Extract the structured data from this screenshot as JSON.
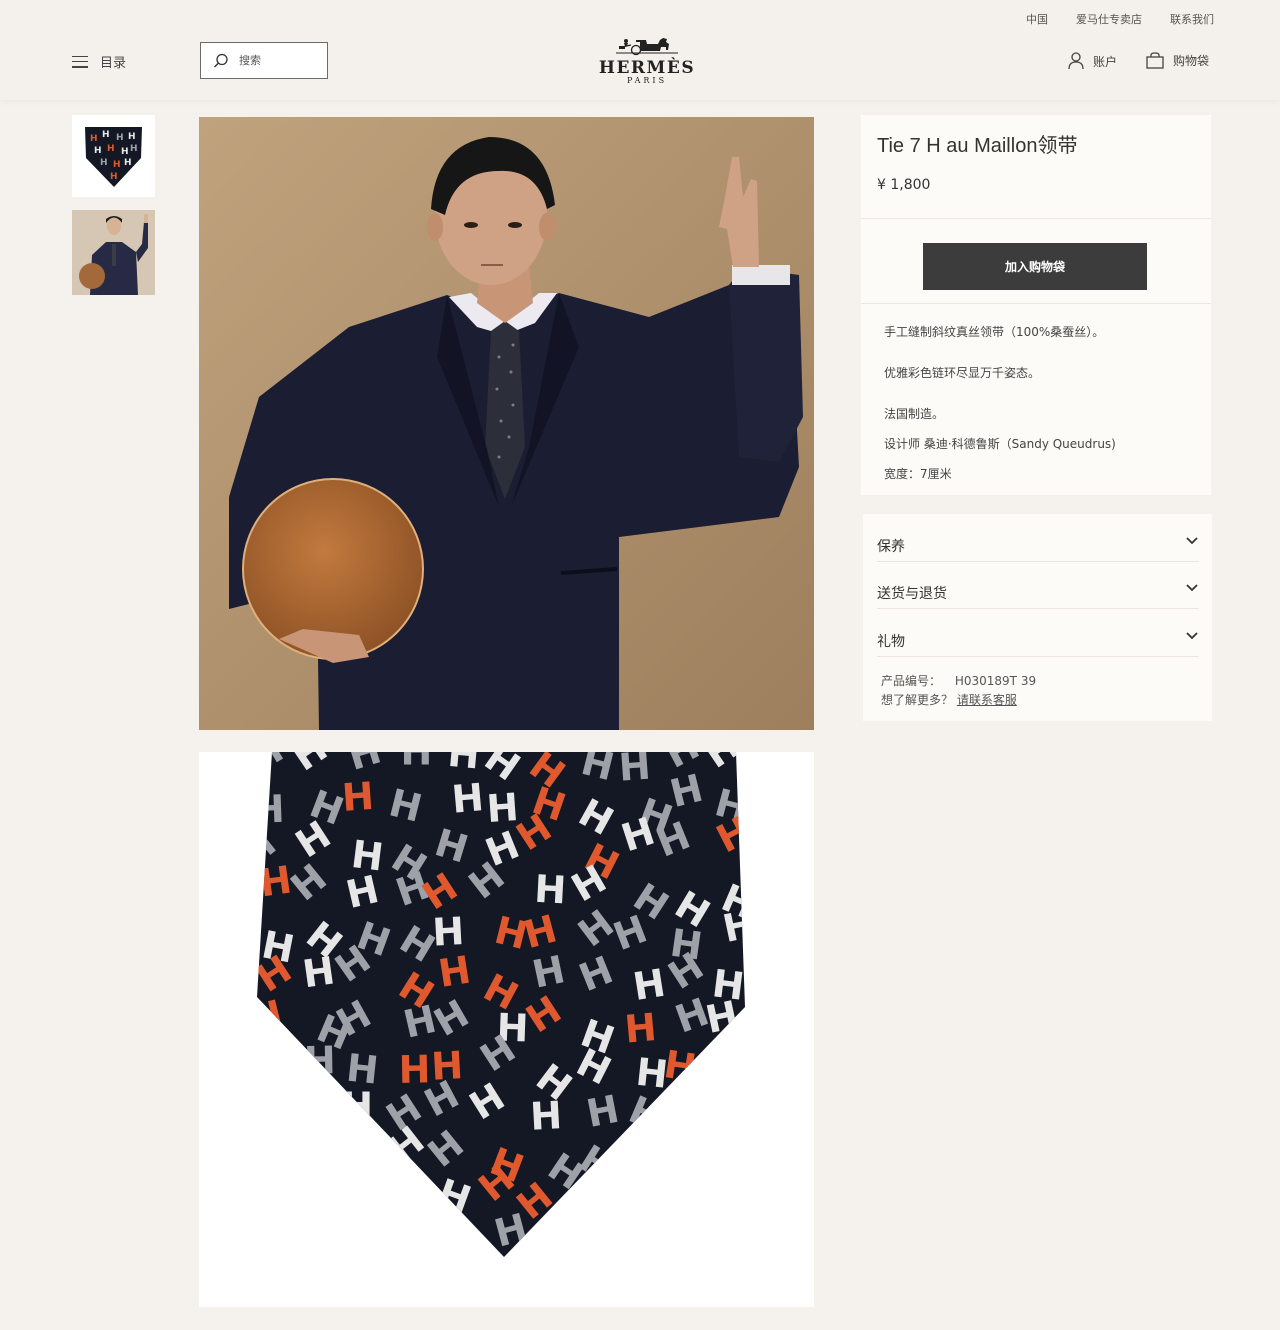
{
  "header": {
    "util_links": [
      "中国",
      "爱马仕专卖店",
      "联系我们"
    ],
    "menu_label": "目录",
    "search_placeholder": "搜索",
    "logo_word": "HERMÈS",
    "logo_sub": "PARIS",
    "account_label": "账户",
    "bag_label": "购物袋"
  },
  "product": {
    "title": "Tie 7 H au Maillon领带",
    "price": "¥ 1,800",
    "add_to_bag": "加入购物袋",
    "description": [
      "手工缝制斜纹真丝领带（100%桑蚕丝）。",
      "优雅彩色链环尽显万千姿态。",
      "法国制造。",
      "设计师 桑迪·科德鲁斯（Sandy Queudrus)",
      "宽度：7厘米"
    ]
  },
  "accordion": [
    "保养",
    "送货与退货",
    "礼物"
  ],
  "reference": {
    "label": "产品编号：",
    "code": "H030189T 39",
    "more": "想了解更多？",
    "link": "请联系客服"
  },
  "colors": {
    "background": "#f5f1ec",
    "button": "#3c3c3c",
    "tie_navy": "#141824",
    "tie_orange": "#e0592e",
    "tie_grey": "#9ea2a8",
    "tie_white": "#e6e6e6"
  },
  "icons": [
    "hamburger-icon",
    "search-icon",
    "hermes-carriage-logo",
    "account-icon",
    "shopping-bag-icon",
    "chevron-down-icon"
  ]
}
